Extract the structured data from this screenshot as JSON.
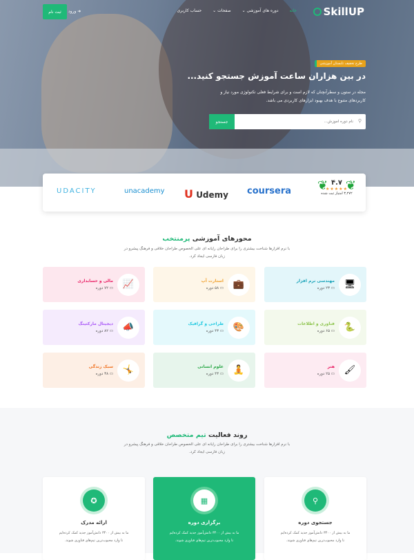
{
  "nav": {
    "logo": "SkillUP",
    "items": [
      "خانه",
      "دوره های آموزشی ⌄",
      "صفحات ⌄",
      "حساب کاربری"
    ],
    "login": "ورود",
    "signup": "ثبت نام"
  },
  "hero": {
    "badge": "طرح تخفیف تابستان آموزشی",
    "title": "در بین هزاران ساعت آموزش جستجو کنید...",
    "description": "مجله در ستون و سطرآنچنان که لازم است و برای شرایط فعلی تکنولوژی مورد نیاز و کاربردهای متنوع با هدف بهبود ابزارهای کاربردی می باشد.",
    "search_placeholder": "نام دوره آموزش...",
    "search_button": "جستجو"
  },
  "partners": {
    "logos": [
      "UDACITY",
      "unacademy",
      "Udemy",
      "coursera"
    ],
    "rating": "۴.۷",
    "rating_count": "۳,۲۷۲ امتیاز ثبت شده",
    "stars": 5
  },
  "categories": {
    "title": "محورهای آموزشی",
    "title_accent": "پرمنتخب",
    "subtitle": "با نرم افزارها شناخت بیشتری را برای طراحان رایانه ای علی الخصوص طراحان خلاقی و فرهنگ پیشرو در زبان فارسی ایجاد کرد.",
    "items": [
      {
        "title": "مهندسی نرم افزار",
        "count": "۲۳ دوره",
        "color": "#17a2b8",
        "bg": "#e3f6fa",
        "icon": "🖥"
      },
      {
        "title": "استارت آپ",
        "count": "۵۸ دوره",
        "color": "#f0a02c",
        "bg": "#fef6e8",
        "icon": "💼"
      },
      {
        "title": "مالی و حسابداری",
        "count": "۷۲ دوره",
        "color": "#e91e63",
        "bg": "#fde7ee",
        "icon": "📈"
      },
      {
        "title": "فناوری و اطلاعات",
        "count": "۶۵ دوره",
        "color": "#8bc34a",
        "bg": "#f3f9ec",
        "icon": "🐍"
      },
      {
        "title": "طراحی و گرافیک",
        "count": "۴۳ دوره",
        "color": "#1ec8e0",
        "bg": "#e4f9fc",
        "icon": "🎨"
      },
      {
        "title": "دیجیتال مارکتینگ",
        "count": "۸۲ دوره",
        "color": "#a855f7",
        "bg": "#f5ebfd",
        "icon": "📣"
      },
      {
        "title": "هنر",
        "count": "۲۵ دوره",
        "color": "#e91e63",
        "bg": "#fdebf2",
        "icon": "🖌"
      },
      {
        "title": "علوم انسانی",
        "count": "۴۳ دوره",
        "color": "#28a745",
        "bg": "#e7f5ec",
        "icon": "🧘"
      },
      {
        "title": "سبک زندگی",
        "count": "۳۸ دوره",
        "color": "#f0701e",
        "bg": "#fdefe5",
        "icon": "🤸"
      }
    ]
  },
  "process": {
    "title": "روند فعالیت",
    "title_accent": "تیم متخصص",
    "subtitle": "با نرم افزارها شناخت بیشتری را برای طراحان رایانه ای علی الخصوص طراحان خلاقی و فرهنگ پیشرو در زبان فارسی ایجاد کرد.",
    "steps": [
      {
        "title": "جستجوی دوره",
        "text": "ما به بیش از ۳۴۰۰ دانش‌آموز جدید کمک کرده‌ایم تا وارد محبوب‌ترین تیم‌های فناوری شوند.",
        "icon": "search-icon"
      },
      {
        "title": "برگزاری دوره",
        "text": "ما به بیش از ۳۴۰۰ دانش‌آموز جدید کمک کرده‌ایم تا وارد محبوب‌ترین تیم‌های فناوری شوند.",
        "icon": "calendar-icon"
      },
      {
        "title": "ارائه مدرک",
        "text": "ما به بیش از ۳۴۰۰ دانش‌آموز جدید کمک کرده‌ایم تا وارد محبوب‌ترین تیم‌های فناوری شوند.",
        "icon": "award-icon"
      }
    ]
  },
  "colors": {
    "primary": "#1fb978",
    "badge": "#e8a21a"
  }
}
